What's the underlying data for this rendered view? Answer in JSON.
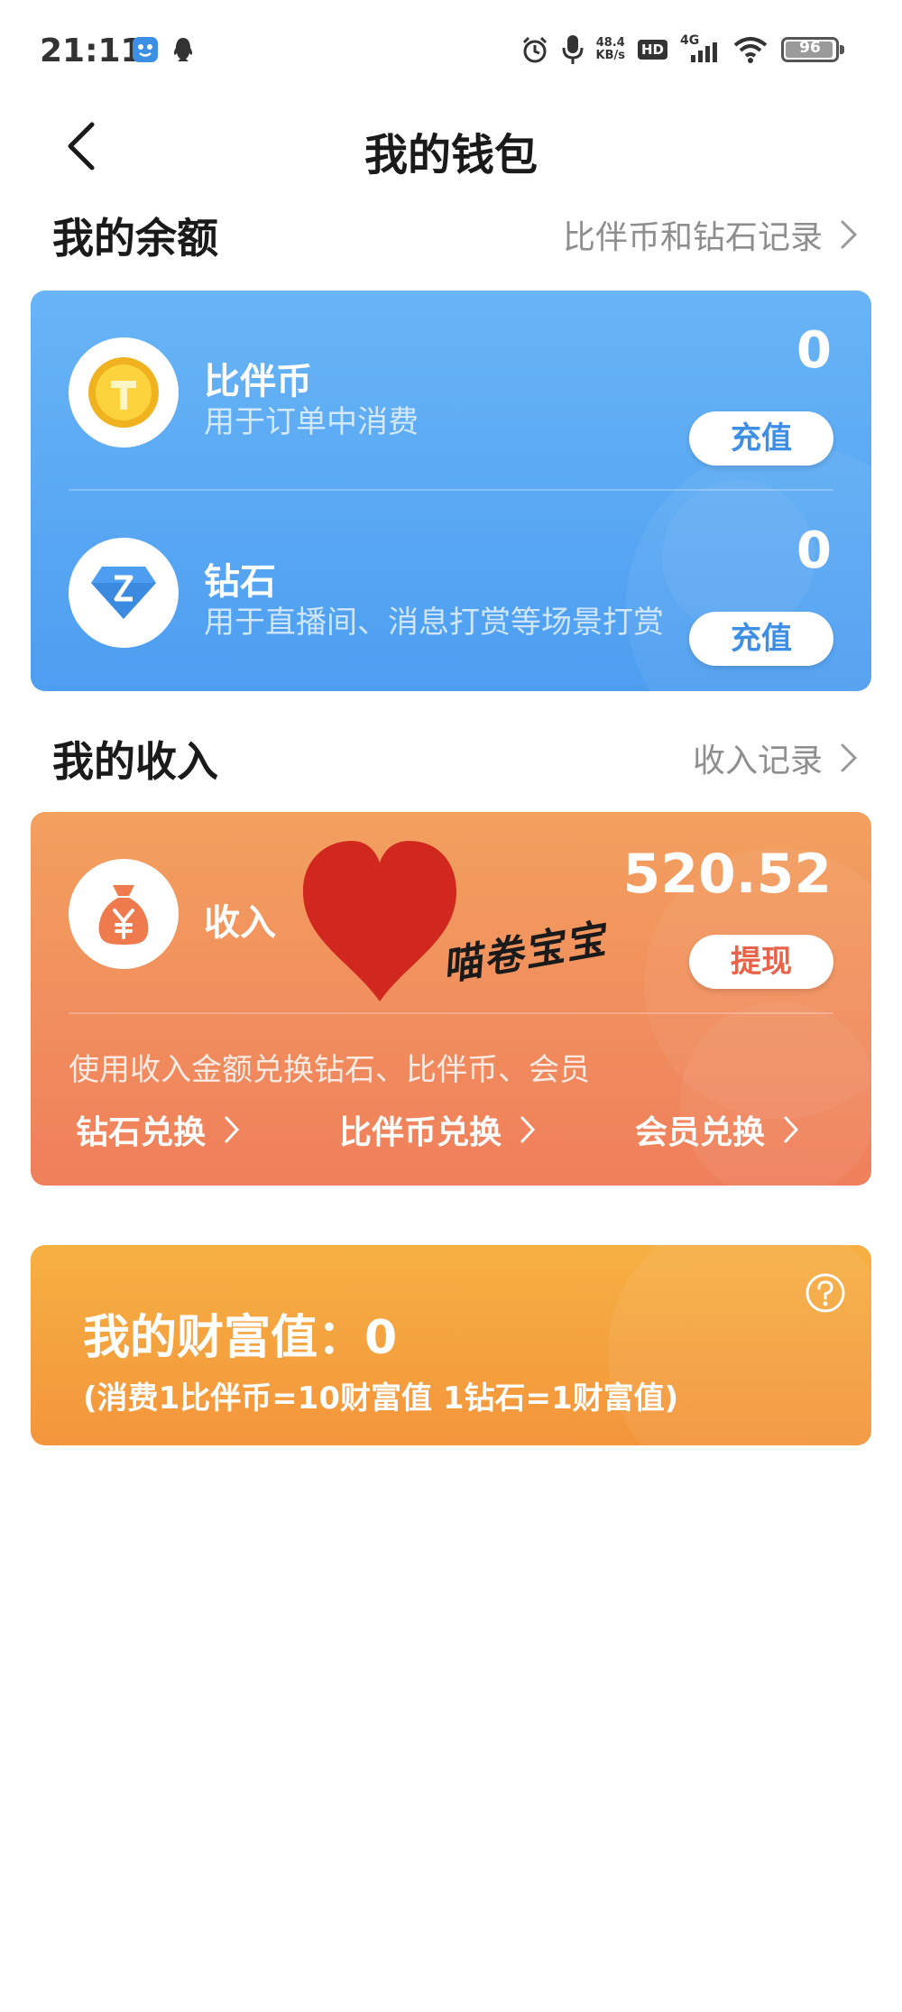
{
  "status_bar": {
    "time": "21:11",
    "net_speed_value": "48.4",
    "net_speed_unit": "KB/s",
    "hd_label": "HD",
    "network_label": "4G",
    "battery_level": "96",
    "icons": [
      "app-notification-icon",
      "qq-icon",
      "alarm-icon",
      "microphone-icon",
      "signal-icon",
      "wifi-icon",
      "battery-icon"
    ]
  },
  "header": {
    "title": "我的钱包",
    "back_icon": "chevron-left-icon"
  },
  "balance_section": {
    "title": "我的余额",
    "link_label": "比伴币和钻石记录",
    "items": [
      {
        "name": "比伴币",
        "desc": "用于订单中消费",
        "amount": "0",
        "button_label": "充值",
        "icon": "gold-coin-icon"
      },
      {
        "name": "钻石",
        "desc": "用于直播间、消息打赏等场景打赏",
        "amount": "0",
        "button_label": "充值",
        "icon": "diamond-icon"
      }
    ]
  },
  "income_section": {
    "title": "我的收入",
    "link_label": "收入记录",
    "name": "收入",
    "amount": "520.52",
    "button_label": "提现",
    "icon": "money-bag-icon",
    "hint": "使用收入金额兑换钻石、比伴币、会员",
    "exchanges": [
      "钻石兑换",
      "比伴币兑换",
      "会员兑换"
    ]
  },
  "wealth": {
    "title": "我的财富值：0",
    "rule": "(消费1比伴币=10财富值 1钻石=1财富值)",
    "help_icon": "question-icon"
  },
  "overlay": {
    "signature_text": "喵卷宝宝",
    "heart_color": "#d0271f"
  },
  "colors": {
    "balance_card": "#5aa8f4",
    "income_card": "#f0905d",
    "wealth_card": "#f4a23f",
    "recharge_text": "#3d8fe6",
    "withdraw_text": "#e8634a"
  }
}
